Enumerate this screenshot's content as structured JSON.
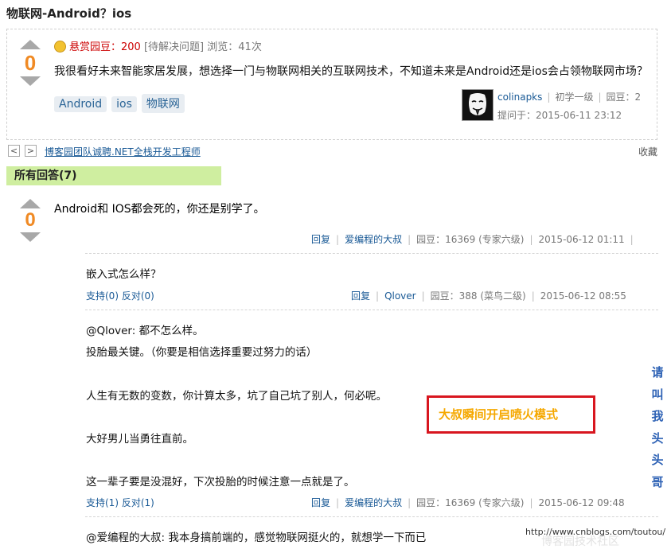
{
  "question": {
    "title": "物联网-Android？ios",
    "score": "0",
    "bounty_label": "悬赏园豆：",
    "bounty_value": "200",
    "status": "[待解决问题]",
    "views": "浏览：41次",
    "body": "我很看好未来智能家居发展，想选择一门与物联网相关的互联网技术，不知道未来是Android还是ios会占领物联网市场？",
    "tags": [
      "Android",
      "ios",
      "物联网"
    ],
    "asker": {
      "name": "colinapks",
      "level": "初学一级",
      "beans": "园豆：2"
    },
    "asked_at": "提问于：2015-06-11 23:12"
  },
  "nav": {
    "prev": "<",
    "next": ">",
    "ad_text": "博客园团队诚聘.NET全栈开发工程师",
    "favorite": "收藏"
  },
  "answers_header": "所有回答(7)",
  "answer": {
    "score": "0",
    "body": "Android和 IOS都会死的，你还是别学了。",
    "meta": {
      "reply": "回复",
      "user": "爱编程的大叔",
      "beans": "园豆：16369 (专家六级)",
      "time": "2015-06-12 01:11"
    }
  },
  "comments": [
    {
      "lines": [
        "嵌入式怎么样？"
      ],
      "support": "支持(0)",
      "oppose": "反对(0)",
      "meta": {
        "reply": "回复",
        "user": "Qlover",
        "beans": "园豆：388 (菜鸟二级)",
        "time": "2015-06-12 08:55"
      }
    },
    {
      "lines": [
        "@Qlover: 都不怎么样。",
        "投胎最关键。（你要是相信选择重要过努力的话）",
        "人生有无数的变数，你计算太多，坑了自己坑了别人，何必呢。",
        "大好男儿当勇往直前。",
        "这一辈子要是没混好，下次投胎的时候注意一点就是了。"
      ],
      "support": "支持(1)",
      "oppose": "反对(1)",
      "meta": {
        "reply": "回复",
        "user": "爱编程的大叔",
        "beans": "园豆：16369 (专家六级)",
        "time": "2015-06-12 09:48"
      }
    },
    {
      "lines": [
        "@爱编程的大叔: 我本身搞前端的，感觉物联网挺火的，就想学一下而已"
      ]
    }
  ],
  "callout_text": "大叔瞬间开启喷火模式",
  "vertical_text": [
    "请",
    "叫",
    "我",
    "头",
    "头",
    "哥"
  ],
  "watermark": "http://www.cnblogs.com/toutou/",
  "watermark_bg": "博客园技术社区",
  "colors": {
    "score": "#f08a24",
    "answers_bar": "#cfeea0",
    "callout_border": "#d8161f",
    "callout_text": "#f5a800",
    "vertical_text": "#2e62b5"
  }
}
